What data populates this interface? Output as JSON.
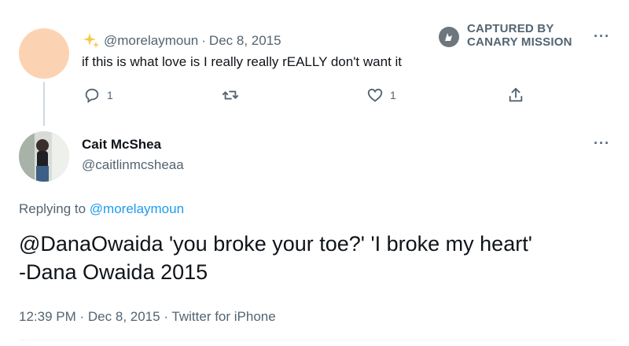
{
  "parent_tweet": {
    "handle": "@morelaymoun",
    "separator": "·",
    "date": "Dec 8, 2015",
    "text": "if this is what love is I really really rEALLY don't want it",
    "replies": "1",
    "likes": "1"
  },
  "watermark": {
    "line1": "CAPTURED BY",
    "line2": "CANARY MISSION"
  },
  "more_label": "···",
  "focal_tweet": {
    "display_name": "Cait McShea",
    "handle": "@caitlinmcsheaa",
    "replying_prefix": "Replying to",
    "replying_to": "@morelaymoun",
    "text_line1": "@DanaOwaida 'you broke your toe?' 'I broke my heart'",
    "text_line2": "-Dana Owaida 2015",
    "time": "12:39 PM",
    "date": "Dec 8, 2015",
    "source": "Twitter for iPhone",
    "separator": "·"
  },
  "icons": {
    "sparkle": "sparkle-icon",
    "reply": "reply-icon",
    "retweet": "retweet-icon",
    "like": "like-icon",
    "share": "share-icon",
    "logo": "canary-mission-logo"
  },
  "colors": {
    "link": "#1d9bf0",
    "muted": "#536471",
    "sparkle": "#f7c948",
    "avatar_placeholder": "#fbd3b3"
  }
}
